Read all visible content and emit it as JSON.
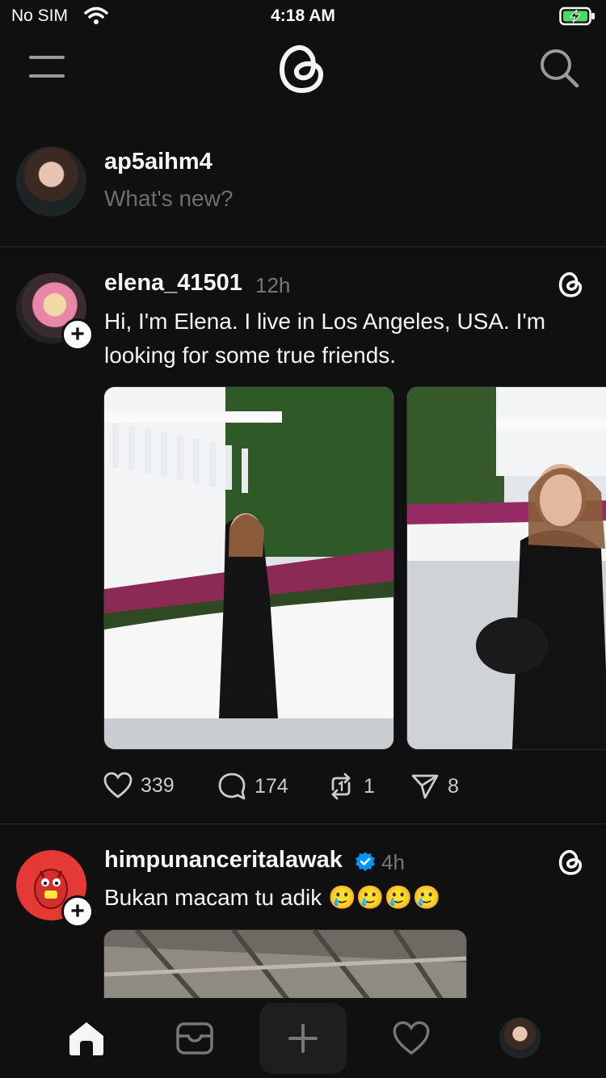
{
  "status_bar": {
    "carrier": "No SIM",
    "time": "4:18 AM"
  },
  "header": {
    "logo_icon": "threads-logo-icon",
    "menu_icon": "menu-icon",
    "search_icon": "search-icon"
  },
  "composer": {
    "username": "ap5aihm4",
    "placeholder": "What's new?"
  },
  "posts": [
    {
      "username": "elena_41501",
      "time": "12h",
      "text": "Hi, I'm Elena. I live in Los Angeles, USA. I'm looking for some true friends.",
      "actions": {
        "likes": "339",
        "comments": "174",
        "reposts": "1",
        "shares": "8"
      }
    },
    {
      "username": "himpunanceritalawak",
      "verified": true,
      "time": "4h",
      "text": "Bukan macam tu adik 🥲🥲🥲🥲"
    }
  ],
  "tab_bar": {
    "items": [
      "home-icon",
      "inbox-icon",
      "new-thread-icon",
      "activity-icon",
      "profile-avatar"
    ]
  },
  "colors": {
    "background": "#101010",
    "verified": "#0095f6",
    "badge_red": "#e53935"
  }
}
